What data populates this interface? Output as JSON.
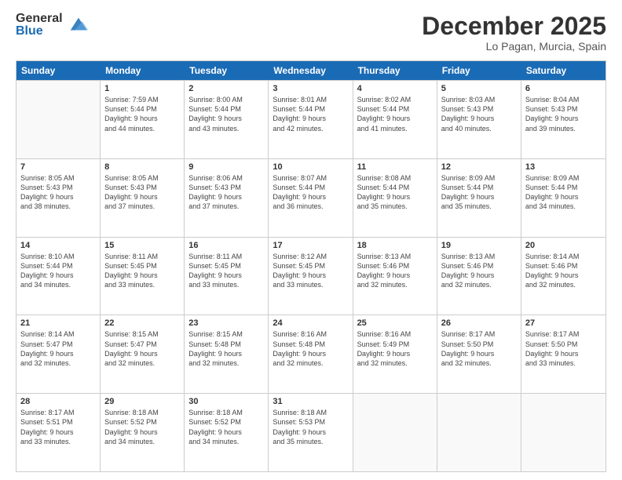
{
  "logo": {
    "general": "General",
    "blue": "Blue"
  },
  "title": "December 2025",
  "location": "Lo Pagan, Murcia, Spain",
  "header_days": [
    "Sunday",
    "Monday",
    "Tuesday",
    "Wednesday",
    "Thursday",
    "Friday",
    "Saturday"
  ],
  "weeks": [
    [
      {
        "day": "",
        "sunrise": "",
        "sunset": "",
        "daylight": ""
      },
      {
        "day": "1",
        "sunrise": "Sunrise: 7:59 AM",
        "sunset": "Sunset: 5:44 PM",
        "daylight": "Daylight: 9 hours and 44 minutes."
      },
      {
        "day": "2",
        "sunrise": "Sunrise: 8:00 AM",
        "sunset": "Sunset: 5:44 PM",
        "daylight": "Daylight: 9 hours and 43 minutes."
      },
      {
        "day": "3",
        "sunrise": "Sunrise: 8:01 AM",
        "sunset": "Sunset: 5:44 PM",
        "daylight": "Daylight: 9 hours and 42 minutes."
      },
      {
        "day": "4",
        "sunrise": "Sunrise: 8:02 AM",
        "sunset": "Sunset: 5:44 PM",
        "daylight": "Daylight: 9 hours and 41 minutes."
      },
      {
        "day": "5",
        "sunrise": "Sunrise: 8:03 AM",
        "sunset": "Sunset: 5:43 PM",
        "daylight": "Daylight: 9 hours and 40 minutes."
      },
      {
        "day": "6",
        "sunrise": "Sunrise: 8:04 AM",
        "sunset": "Sunset: 5:43 PM",
        "daylight": "Daylight: 9 hours and 39 minutes."
      }
    ],
    [
      {
        "day": "7",
        "sunrise": "Sunrise: 8:05 AM",
        "sunset": "Sunset: 5:43 PM",
        "daylight": "Daylight: 9 hours and 38 minutes."
      },
      {
        "day": "8",
        "sunrise": "Sunrise: 8:05 AM",
        "sunset": "Sunset: 5:43 PM",
        "daylight": "Daylight: 9 hours and 37 minutes."
      },
      {
        "day": "9",
        "sunrise": "Sunrise: 8:06 AM",
        "sunset": "Sunset: 5:43 PM",
        "daylight": "Daylight: 9 hours and 37 minutes."
      },
      {
        "day": "10",
        "sunrise": "Sunrise: 8:07 AM",
        "sunset": "Sunset: 5:44 PM",
        "daylight": "Daylight: 9 hours and 36 minutes."
      },
      {
        "day": "11",
        "sunrise": "Sunrise: 8:08 AM",
        "sunset": "Sunset: 5:44 PM",
        "daylight": "Daylight: 9 hours and 35 minutes."
      },
      {
        "day": "12",
        "sunrise": "Sunrise: 8:09 AM",
        "sunset": "Sunset: 5:44 PM",
        "daylight": "Daylight: 9 hours and 35 minutes."
      },
      {
        "day": "13",
        "sunrise": "Sunrise: 8:09 AM",
        "sunset": "Sunset: 5:44 PM",
        "daylight": "Daylight: 9 hours and 34 minutes."
      }
    ],
    [
      {
        "day": "14",
        "sunrise": "Sunrise: 8:10 AM",
        "sunset": "Sunset: 5:44 PM",
        "daylight": "Daylight: 9 hours and 34 minutes."
      },
      {
        "day": "15",
        "sunrise": "Sunrise: 8:11 AM",
        "sunset": "Sunset: 5:45 PM",
        "daylight": "Daylight: 9 hours and 33 minutes."
      },
      {
        "day": "16",
        "sunrise": "Sunrise: 8:11 AM",
        "sunset": "Sunset: 5:45 PM",
        "daylight": "Daylight: 9 hours and 33 minutes."
      },
      {
        "day": "17",
        "sunrise": "Sunrise: 8:12 AM",
        "sunset": "Sunset: 5:45 PM",
        "daylight": "Daylight: 9 hours and 33 minutes."
      },
      {
        "day": "18",
        "sunrise": "Sunrise: 8:13 AM",
        "sunset": "Sunset: 5:46 PM",
        "daylight": "Daylight: 9 hours and 32 minutes."
      },
      {
        "day": "19",
        "sunrise": "Sunrise: 8:13 AM",
        "sunset": "Sunset: 5:46 PM",
        "daylight": "Daylight: 9 hours and 32 minutes."
      },
      {
        "day": "20",
        "sunrise": "Sunrise: 8:14 AM",
        "sunset": "Sunset: 5:46 PM",
        "daylight": "Daylight: 9 hours and 32 minutes."
      }
    ],
    [
      {
        "day": "21",
        "sunrise": "Sunrise: 8:14 AM",
        "sunset": "Sunset: 5:47 PM",
        "daylight": "Daylight: 9 hours and 32 minutes."
      },
      {
        "day": "22",
        "sunrise": "Sunrise: 8:15 AM",
        "sunset": "Sunset: 5:47 PM",
        "daylight": "Daylight: 9 hours and 32 minutes."
      },
      {
        "day": "23",
        "sunrise": "Sunrise: 8:15 AM",
        "sunset": "Sunset: 5:48 PM",
        "daylight": "Daylight: 9 hours and 32 minutes."
      },
      {
        "day": "24",
        "sunrise": "Sunrise: 8:16 AM",
        "sunset": "Sunset: 5:48 PM",
        "daylight": "Daylight: 9 hours and 32 minutes."
      },
      {
        "day": "25",
        "sunrise": "Sunrise: 8:16 AM",
        "sunset": "Sunset: 5:49 PM",
        "daylight": "Daylight: 9 hours and 32 minutes."
      },
      {
        "day": "26",
        "sunrise": "Sunrise: 8:17 AM",
        "sunset": "Sunset: 5:50 PM",
        "daylight": "Daylight: 9 hours and 32 minutes."
      },
      {
        "day": "27",
        "sunrise": "Sunrise: 8:17 AM",
        "sunset": "Sunset: 5:50 PM",
        "daylight": "Daylight: 9 hours and 33 minutes."
      }
    ],
    [
      {
        "day": "28",
        "sunrise": "Sunrise: 8:17 AM",
        "sunset": "Sunset: 5:51 PM",
        "daylight": "Daylight: 9 hours and 33 minutes."
      },
      {
        "day": "29",
        "sunrise": "Sunrise: 8:18 AM",
        "sunset": "Sunset: 5:52 PM",
        "daylight": "Daylight: 9 hours and 34 minutes."
      },
      {
        "day": "30",
        "sunrise": "Sunrise: 8:18 AM",
        "sunset": "Sunset: 5:52 PM",
        "daylight": "Daylight: 9 hours and 34 minutes."
      },
      {
        "day": "31",
        "sunrise": "Sunrise: 8:18 AM",
        "sunset": "Sunset: 5:53 PM",
        "daylight": "Daylight: 9 hours and 35 minutes."
      },
      {
        "day": "",
        "sunrise": "",
        "sunset": "",
        "daylight": ""
      },
      {
        "day": "",
        "sunrise": "",
        "sunset": "",
        "daylight": ""
      },
      {
        "day": "",
        "sunrise": "",
        "sunset": "",
        "daylight": ""
      }
    ]
  ]
}
